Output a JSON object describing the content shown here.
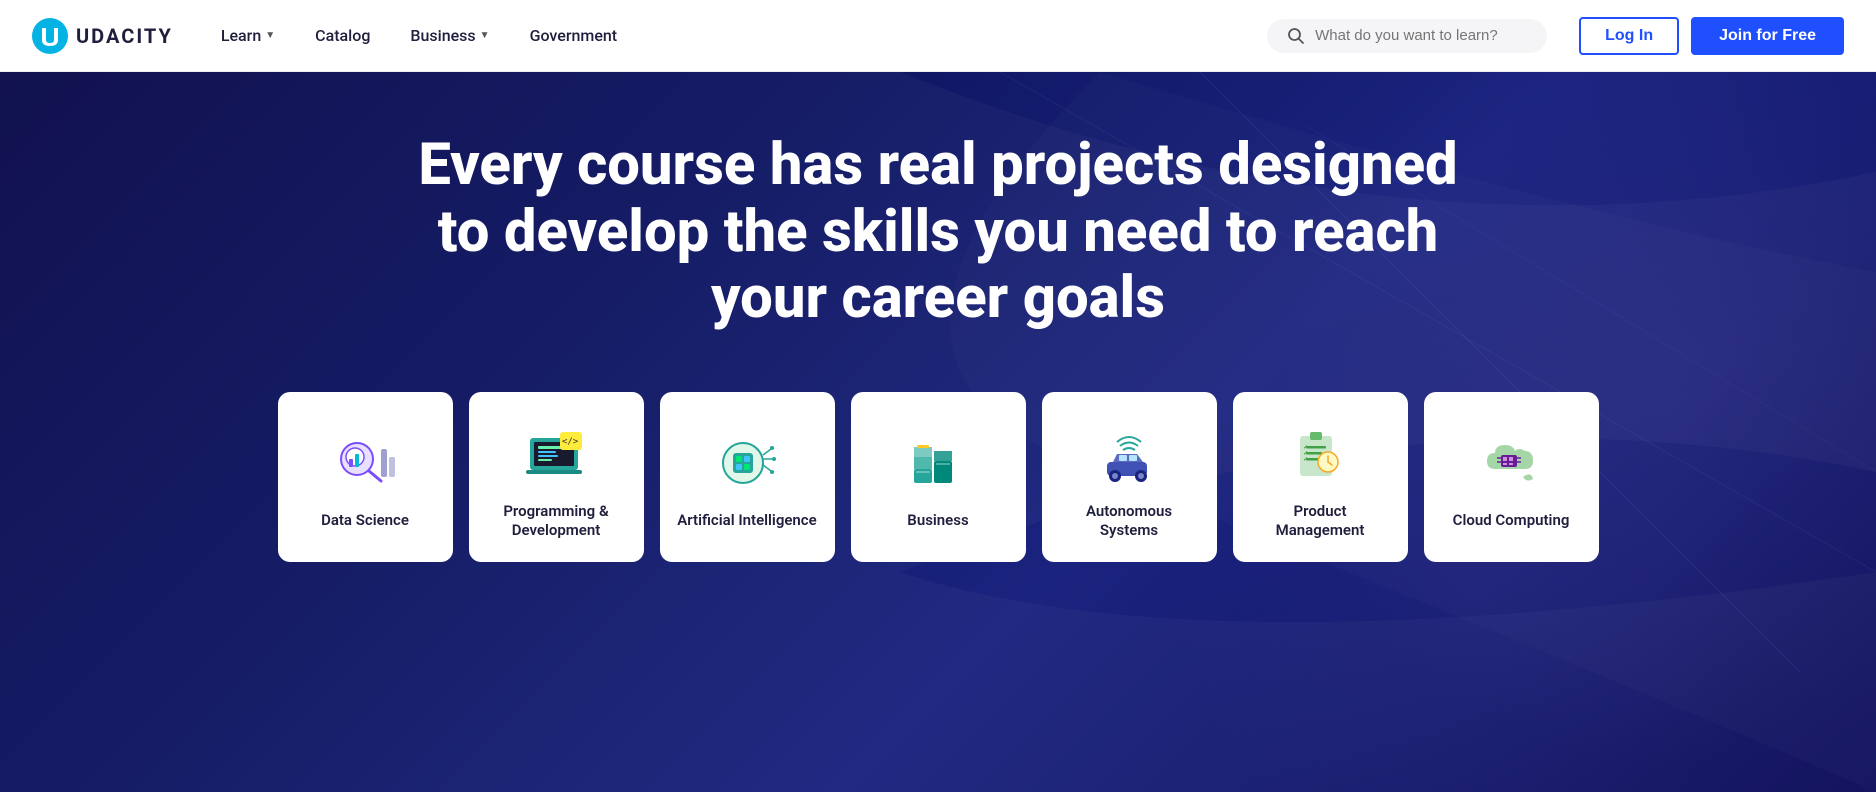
{
  "navbar": {
    "logo_text": "UDACITY",
    "nav_items": [
      {
        "label": "Learn",
        "has_dropdown": true
      },
      {
        "label": "Catalog",
        "has_dropdown": false
      },
      {
        "label": "Business",
        "has_dropdown": true
      },
      {
        "label": "Government",
        "has_dropdown": false
      }
    ],
    "search_placeholder": "What do you want to learn?",
    "login_label": "Log In",
    "join_label": "Join for Free"
  },
  "hero": {
    "title": "Every course has real projects designed to develop the skills you need to reach your career goals"
  },
  "categories": [
    {
      "label": "Data Science",
      "icon": "data-science"
    },
    {
      "label": "Programming & Development",
      "icon": "programming"
    },
    {
      "label": "Artificial Intelligence",
      "icon": "ai"
    },
    {
      "label": "Business",
      "icon": "business"
    },
    {
      "label": "Autonomous Systems",
      "icon": "autonomous"
    },
    {
      "label": "Product Management",
      "icon": "product"
    },
    {
      "label": "Cloud Computing",
      "icon": "cloud"
    }
  ]
}
